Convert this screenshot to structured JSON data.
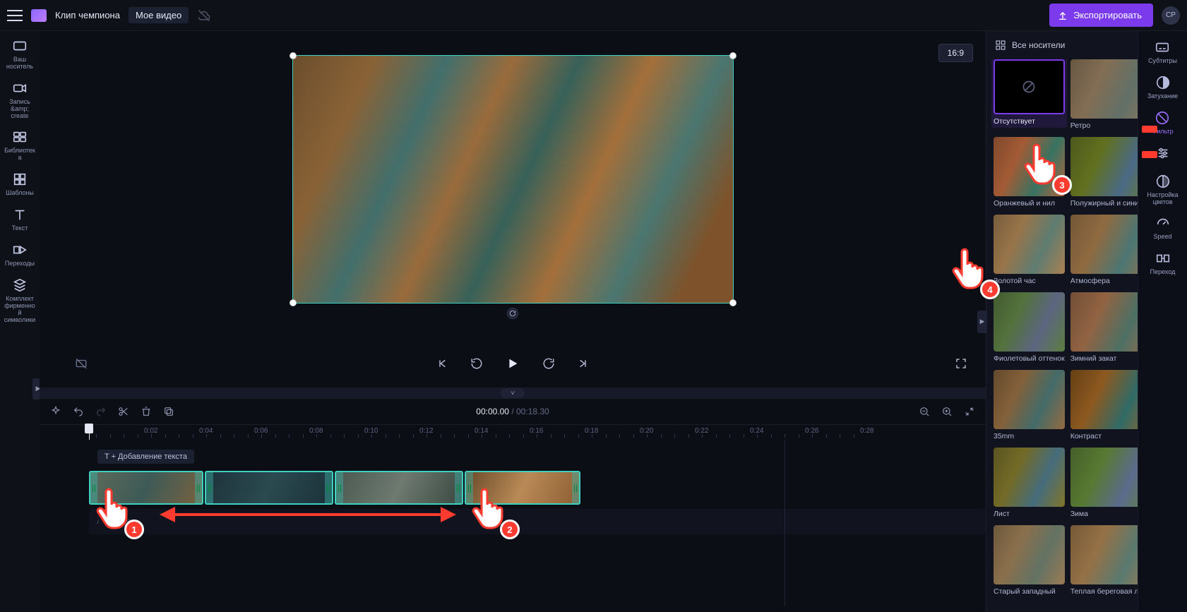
{
  "topbar": {
    "project_title": "Клип чемпиона",
    "subtitle": "Мое видео",
    "export_label": "Экспортировать",
    "avatar_initials": "CP"
  },
  "stage": {
    "aspect_label": "16:9"
  },
  "left_rail": {
    "items": [
      {
        "label": "Ваш носитель"
      },
      {
        "label": "Запись &amp; create"
      },
      {
        "label": "Библиотека"
      },
      {
        "label": "Шаблоны"
      },
      {
        "label": "Текст"
      },
      {
        "label": "Переходы"
      },
      {
        "label": "Комплект фирменной символики"
      }
    ]
  },
  "right_rail": {
    "items": [
      {
        "label": "Субтитры"
      },
      {
        "label": "Затухание"
      },
      {
        "label": "Фильтр"
      },
      {
        "label": ""
      },
      {
        "label": "Настройка цветов"
      },
      {
        "label": "Speed"
      },
      {
        "label": "Переход"
      }
    ]
  },
  "timeline": {
    "time_current": "00:00.00",
    "time_total": "00:18.30",
    "add_text_hint": "T + Добавление текста",
    "audio_placeholder": "♪ + Аудио",
    "ruler_marks": [
      "0:02",
      "0:04",
      "0:06",
      "0:08",
      "0:10",
      "0:12",
      "0:14",
      "0:16",
      "0:18",
      "0:20",
      "0:22",
      "0:24",
      "0:26",
      "0:28"
    ]
  },
  "filter_panel": {
    "header": "Все носители",
    "filters": [
      {
        "name": "Отсутствует",
        "cls": "none",
        "selected": true
      },
      {
        "name": "Ретро",
        "cls": "retro"
      },
      {
        "name": "Оранжевый и нил",
        "cls": "orange"
      },
      {
        "name": "Полужирный и синий",
        "cls": "blue"
      },
      {
        "name": "Золотой час",
        "cls": "gold"
      },
      {
        "name": "Атмосфера",
        "cls": "atmo"
      },
      {
        "name": "Фиолетовый оттенок",
        "cls": "violet"
      },
      {
        "name": "Зимний закат",
        "cls": "sunset"
      },
      {
        "name": "35mm",
        "cls": "mm"
      },
      {
        "name": "Контраст",
        "cls": "contr"
      },
      {
        "name": "Лист",
        "cls": "leaf"
      },
      {
        "name": "Зима",
        "cls": "winter"
      },
      {
        "name": "Старый западный",
        "cls": "oldwest"
      },
      {
        "name": "Теплая береговая линия",
        "cls": "warm"
      }
    ]
  },
  "annotations": {
    "badge_1": "1",
    "badge_2": "2",
    "badge_3": "3",
    "badge_4": "4"
  }
}
